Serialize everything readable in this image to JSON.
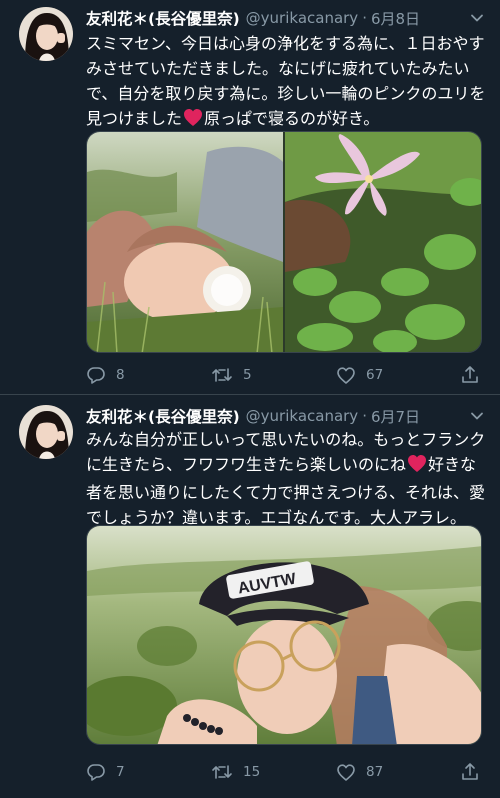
{
  "colors": {
    "background": "#15202b",
    "divider": "#38444d",
    "text_primary": "#ffffff",
    "text_secondary": "#8899a6",
    "heart_emoji": "#e0245e"
  },
  "tweets": [
    {
      "display_name": "友利花＊(長谷優里奈)",
      "handle": "@yurikacanary",
      "separator": "·",
      "date": "6月8日",
      "text_lines": [
        "スミマセン、今日は心身の浄化をする為に、１日おやす",
        "みさせていただきました。なにげに疲れていたみたい",
        "で、自分を取り戻す為に。珍しい一輪のピンクのユリを",
        [
          "見つけました",
          "原っぱで寝るのが好き。"
        ]
      ],
      "media_count": 2,
      "replies": "8",
      "retweets": "5",
      "likes": "67"
    },
    {
      "display_name": "友利花＊(長谷優里奈)",
      "handle": "@yurikacanary",
      "separator": "·",
      "date": "6月7日",
      "text_lines": [
        "みんな自分が正しいって思いたいのね。もっとフランク",
        [
          "に生きたら、フワフワ生きたら楽しいのにね",
          "好きな"
        ],
        "者を思い通りにしたくて力で押さえつける、それは、愛",
        "でしょうか？違います。エゴなんです。大人アラレ。"
      ],
      "cap_text": "AUVTW",
      "media_count": 1,
      "replies": "7",
      "retweets": "15",
      "likes": "87"
    }
  ],
  "icons": {
    "reply": "reply-icon",
    "retweet": "retweet-icon",
    "like": "like-icon",
    "share": "share-icon",
    "caret": "chevron-down-icon",
    "heart": "red-heart-emoji-icon"
  }
}
